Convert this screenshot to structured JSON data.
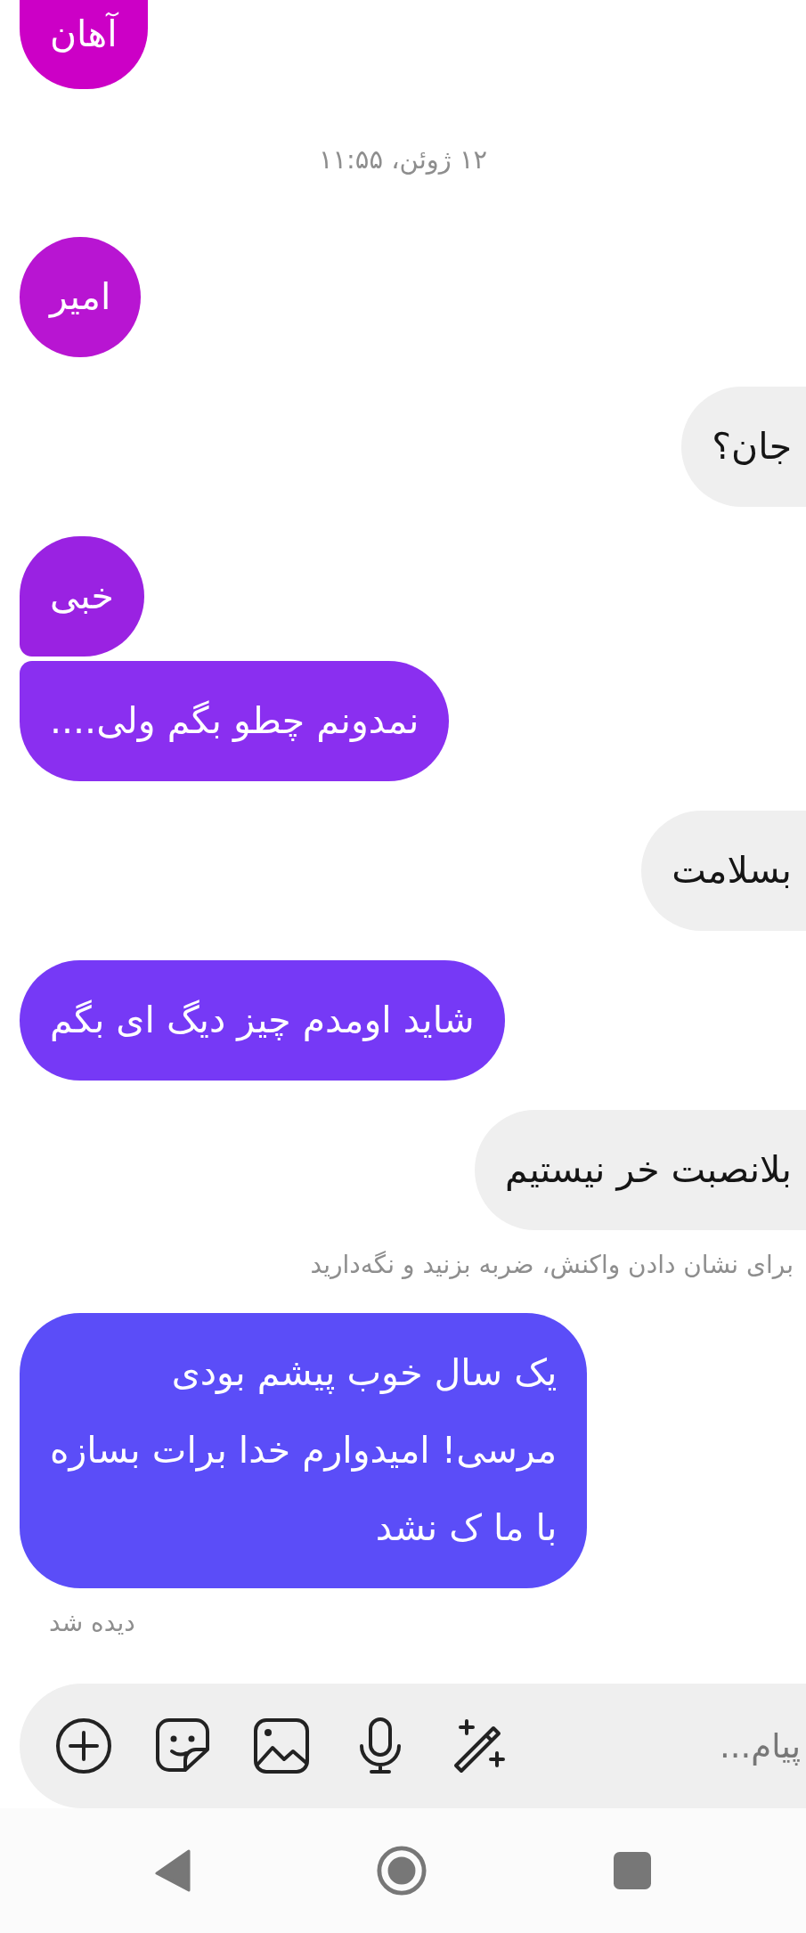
{
  "messages": [
    {
      "kind": "sent",
      "text": "آهان",
      "color": "#cc00c6",
      "continued": false,
      "cut_top": true
    },
    {
      "kind": "time",
      "text": "۱۲ ژوئن، ۱۱:۵۵"
    },
    {
      "kind": "sent",
      "text": "امیر",
      "color": "#b815d2",
      "continued": false,
      "cut_top": false
    },
    {
      "kind": "received",
      "text": "جان؟",
      "continued": false
    },
    {
      "kind": "sent",
      "text": "خبی",
      "color": "#9a22e2",
      "continued": false,
      "cut_top": false
    },
    {
      "kind": "sent",
      "text": "نمدونم چطو بگم ولی....",
      "color": "#8a2ff0",
      "continued": true,
      "cut_top": false
    },
    {
      "kind": "received",
      "text": "بسلامت",
      "continued": false
    },
    {
      "kind": "sent",
      "text": "شاید اومدم چیز دیگ ای بگم",
      "color": "#7639f6",
      "continued": false,
      "cut_top": false
    },
    {
      "kind": "received",
      "text": "بلانصبت خر نیستیم",
      "continued": false
    },
    {
      "kind": "hint",
      "text": "برای نشان دادن واکنش، ضربه بزنید و نگه‌دارید"
    },
    {
      "kind": "sent",
      "lines": [
        "یک سال خوب پیشم بودی",
        "مرسی! امیدوارم خدا برات بسازه",
        "با ما ک نشد"
      ],
      "color": "#5b4df8",
      "continued": false,
      "cut_top": false
    },
    {
      "kind": "seen",
      "text": "دیده شد"
    }
  ],
  "composer": {
    "placeholder": "پیام..."
  }
}
